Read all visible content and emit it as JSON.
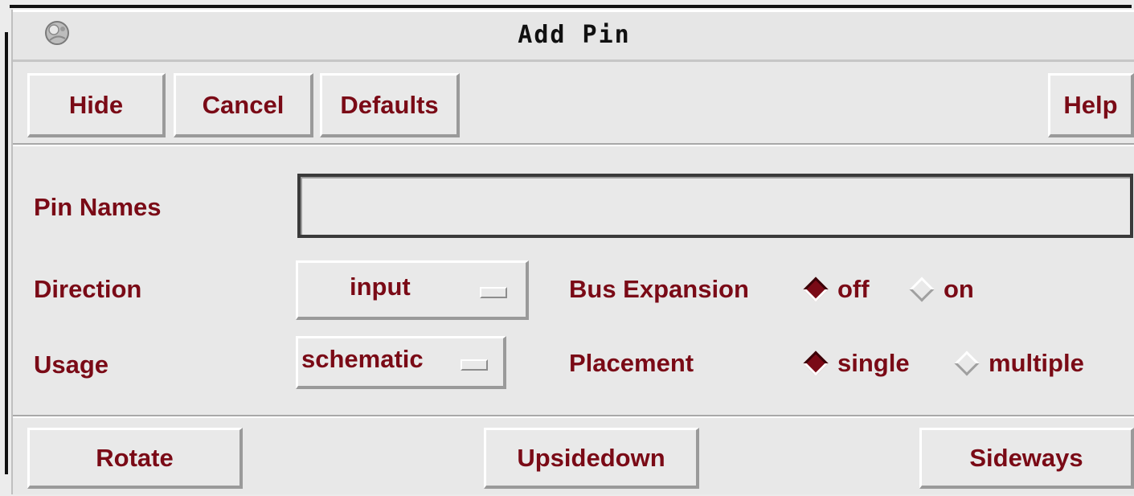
{
  "window": {
    "title": "Add Pin",
    "icon": "window-menu-icon"
  },
  "toolbar": {
    "hide_label": "Hide",
    "cancel_label": "Cancel",
    "defaults_label": "Defaults",
    "help_label": "Help"
  },
  "form": {
    "pin_names_label": "Pin Names",
    "pin_names_value": "",
    "direction_label": "Direction",
    "direction_value": "input",
    "usage_label": "Usage",
    "usage_value": "schematic",
    "bus_expansion_label": "Bus Expansion",
    "bus_expansion_options": [
      {
        "label": "off",
        "selected": true
      },
      {
        "label": "on",
        "selected": false
      }
    ],
    "placement_label": "Placement",
    "placement_options": [
      {
        "label": "single",
        "selected": true
      },
      {
        "label": "multiple",
        "selected": false
      }
    ]
  },
  "actions": {
    "rotate_label": "Rotate",
    "upsidedown_label": "Upsidedown",
    "sideways_label": "Sideways"
  },
  "colors": {
    "label_text": "#7a0a16",
    "background": "#e8e8e8",
    "title_text": "#111111"
  }
}
